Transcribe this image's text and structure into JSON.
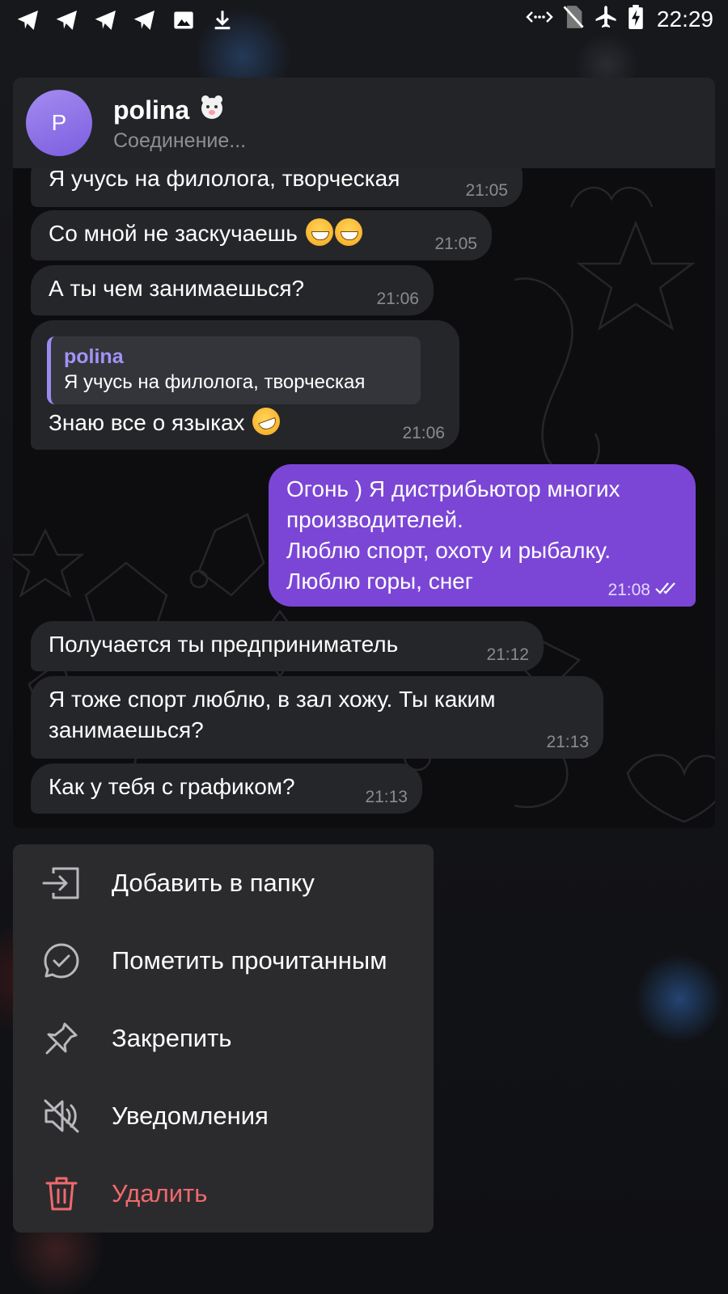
{
  "status_bar": {
    "time": "22:29",
    "left_icons": [
      "telegram-icon",
      "telegram-icon",
      "telegram-icon",
      "telegram-icon",
      "image-icon",
      "download-icon"
    ],
    "right_icons": [
      "data-saver-icon",
      "no-sim-icon",
      "airplane-icon",
      "battery-charging-icon"
    ]
  },
  "chat": {
    "avatar_letter": "P",
    "name": "polina",
    "status": "Соединение...",
    "messages": [
      {
        "text": "Я учусь на филолога, творческая",
        "time": "21:05",
        "direction": "in"
      },
      {
        "text": "Со мной не заскучаешь",
        "emoji": "grinning-face-emoji",
        "time": "21:05",
        "direction": "in"
      },
      {
        "text": "А ты чем занимаешься?",
        "time": "21:06",
        "direction": "in"
      },
      {
        "reply_name": "polina",
        "reply_text": "Я учусь на филолога, творческая",
        "text": "Знаю все о языках",
        "emoji": "rofl-emoji",
        "time": "21:06",
        "direction": "in"
      },
      {
        "lines": [
          "Огонь ) Я дистрибьютор многих",
          "производителей.",
          "Люблю спорт, охоту и рыбалку.",
          "Люблю горы, снег"
        ],
        "time": "21:08",
        "direction": "out",
        "read": true
      },
      {
        "text": "Получается ты предприниматель",
        "time": "21:12",
        "direction": "in"
      },
      {
        "lines": [
          "Я тоже спорт люблю, в зал хожу. Ты каким",
          "занимаешься?"
        ],
        "time": "21:13",
        "direction": "in"
      },
      {
        "text": "Как у тебя с графиком?",
        "time": "21:13",
        "direction": "in"
      }
    ]
  },
  "menu": {
    "items": [
      {
        "label": "Добавить в папку",
        "icon": "add-to-folder-icon"
      },
      {
        "label": "Пометить прочитанным",
        "icon": "mark-read-icon"
      },
      {
        "label": "Закрепить",
        "icon": "pin-icon"
      },
      {
        "label": "Уведомления",
        "icon": "mute-icon"
      },
      {
        "label": "Удалить",
        "icon": "trash-icon",
        "danger": true
      }
    ]
  },
  "colors": {
    "outgoing_bubble": "#7b46d6",
    "incoming_bubble": "#252629",
    "danger": "#f0696c",
    "reply_accent": "#9b8af2"
  }
}
